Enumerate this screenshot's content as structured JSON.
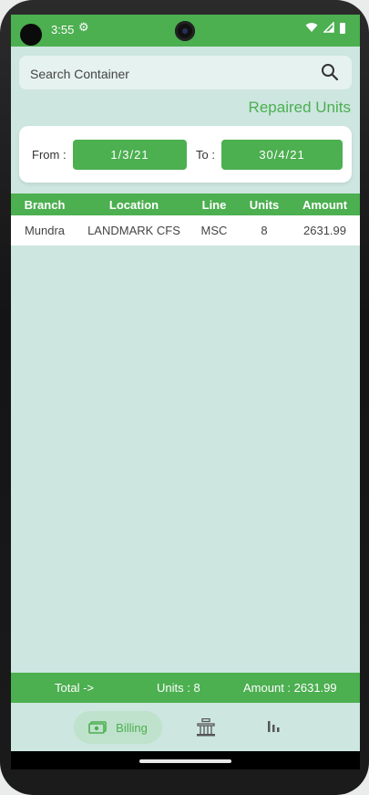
{
  "status": {
    "time": "3:55"
  },
  "search": {
    "placeholder": "Search Container",
    "value": ""
  },
  "page": {
    "title": "Repaired Units"
  },
  "dates": {
    "from_label": "From :",
    "from_value": "1/3/21",
    "to_label": "To :",
    "to_value": "30/4/21"
  },
  "table": {
    "headers": [
      "Branch",
      "Location",
      "Line",
      "Units",
      "Amount"
    ],
    "rows": [
      [
        "Mundra",
        "LANDMARK CFS",
        "MSC",
        "8",
        "2631.99"
      ]
    ]
  },
  "summary": {
    "total": "Total ->",
    "units": "Units : 8",
    "amount": "Amount : 2631.99"
  },
  "nav": {
    "billing_label": "Billing"
  },
  "colors": {
    "accent": "#4caf50",
    "background": "#cde6e0"
  },
  "icons": [
    "settings-icon",
    "wifi-icon",
    "signal-icon",
    "battery-icon",
    "search-icon",
    "billing-cash-icon",
    "building-icon",
    "bar-chart-icon"
  ]
}
